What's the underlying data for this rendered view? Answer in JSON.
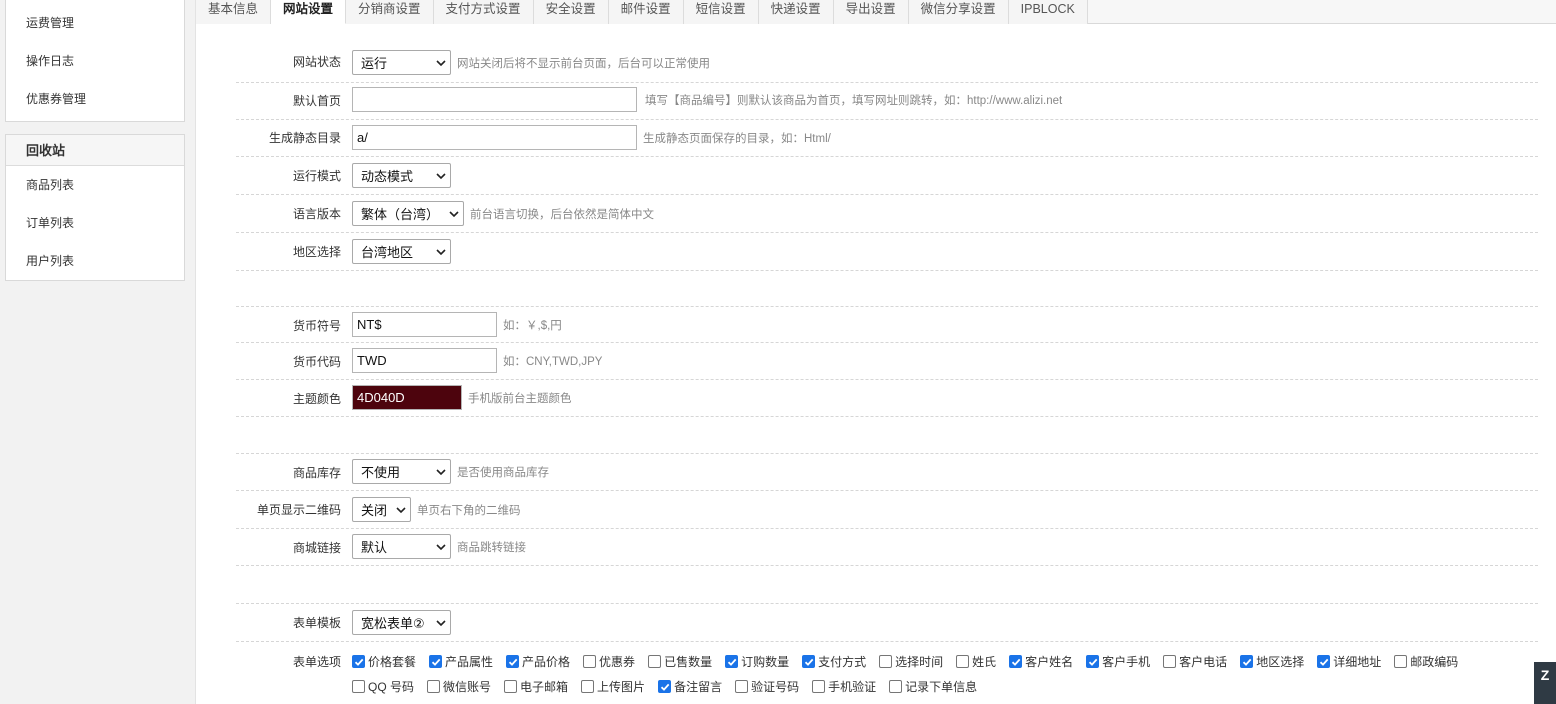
{
  "sidebar": {
    "panel1_items": [
      "运费管理",
      "操作日志",
      "优惠券管理"
    ],
    "panel2_title": "回收站",
    "panel2_items": [
      "商品列表",
      "订单列表",
      "用户列表"
    ]
  },
  "tabs": [
    "基本信息",
    "网站设置",
    "分销商设置",
    "支付方式设置",
    "安全设置",
    "邮件设置",
    "短信设置",
    "快递设置",
    "导出设置",
    "微信分享设置",
    "IPBLOCK"
  ],
  "active_tab": "网站设置",
  "form": {
    "site_status": {
      "label": "网站状态",
      "value": "运行",
      "hint": "网站关闭后将不显示前台页面，后台可以正常使用"
    },
    "default_home": {
      "label": "默认首页",
      "value": "",
      "hint": "填写【商品编号】则默认该商品为首页，填写网址则跳转，如：http://www.alizi.net"
    },
    "static_dir": {
      "label": "生成静态目录",
      "value": "a/",
      "hint": "生成静态页面保存的目录，如：Html/"
    },
    "run_mode": {
      "label": "运行模式",
      "value": "动态模式"
    },
    "language": {
      "label": "语言版本",
      "value": "繁体（台湾）",
      "hint": "前台语言切换，后台依然是简体中文"
    },
    "region": {
      "label": "地区选择",
      "value": "台湾地区"
    },
    "currency_symbol": {
      "label": "货币符号",
      "value": "NT$",
      "hint": "如：￥,$,円"
    },
    "currency_code": {
      "label": "货币代码",
      "value": "TWD",
      "hint": "如：CNY,TWD,JPY"
    },
    "theme_color": {
      "label": "主题颜色",
      "value": "4D040D",
      "hint": "手机版前台主题颜色",
      "color": "#4D040D"
    },
    "stock": {
      "label": "商品库存",
      "value": "不使用",
      "hint": "是否使用商品库存"
    },
    "qrcode": {
      "label": "单页显示二维码",
      "value": "关闭",
      "hint": "单页右下角的二维码"
    },
    "mall_link": {
      "label": "商城链接",
      "value": "默认",
      "hint": "商品跳转链接"
    },
    "form_template": {
      "label": "表单模板",
      "value": "宽松表单②"
    },
    "form_options": {
      "label": "表单选项",
      "items": [
        {
          "text": "价格套餐",
          "checked": true
        },
        {
          "text": "产品属性",
          "checked": true
        },
        {
          "text": "产品价格",
          "checked": true
        },
        {
          "text": "优惠券",
          "checked": false
        },
        {
          "text": "已售数量",
          "checked": false
        },
        {
          "text": "订购数量",
          "checked": true
        },
        {
          "text": "支付方式",
          "checked": true
        },
        {
          "text": "选择时间",
          "checked": false
        },
        {
          "text": "姓氏",
          "checked": false
        },
        {
          "text": "客户姓名",
          "checked": true
        },
        {
          "text": "客户手机",
          "checked": true
        },
        {
          "text": "客户电话",
          "checked": false
        },
        {
          "text": "地区选择",
          "checked": true
        },
        {
          "text": "详细地址",
          "checked": true
        },
        {
          "text": "邮政编码",
          "checked": false
        },
        {
          "text": "QQ 号码",
          "checked": false
        },
        {
          "text": "微信账号",
          "checked": false
        },
        {
          "text": "电子邮箱",
          "checked": false
        },
        {
          "text": "上传图片",
          "checked": false
        },
        {
          "text": "备注留言",
          "checked": true
        },
        {
          "text": "验证号码",
          "checked": false
        },
        {
          "text": "手机验证",
          "checked": false
        },
        {
          "text": "记录下单信息",
          "checked": false
        }
      ]
    }
  },
  "colors": {
    "accent": "#1a73e8",
    "theme": "#4D040D"
  },
  "corner_badge": "Z"
}
